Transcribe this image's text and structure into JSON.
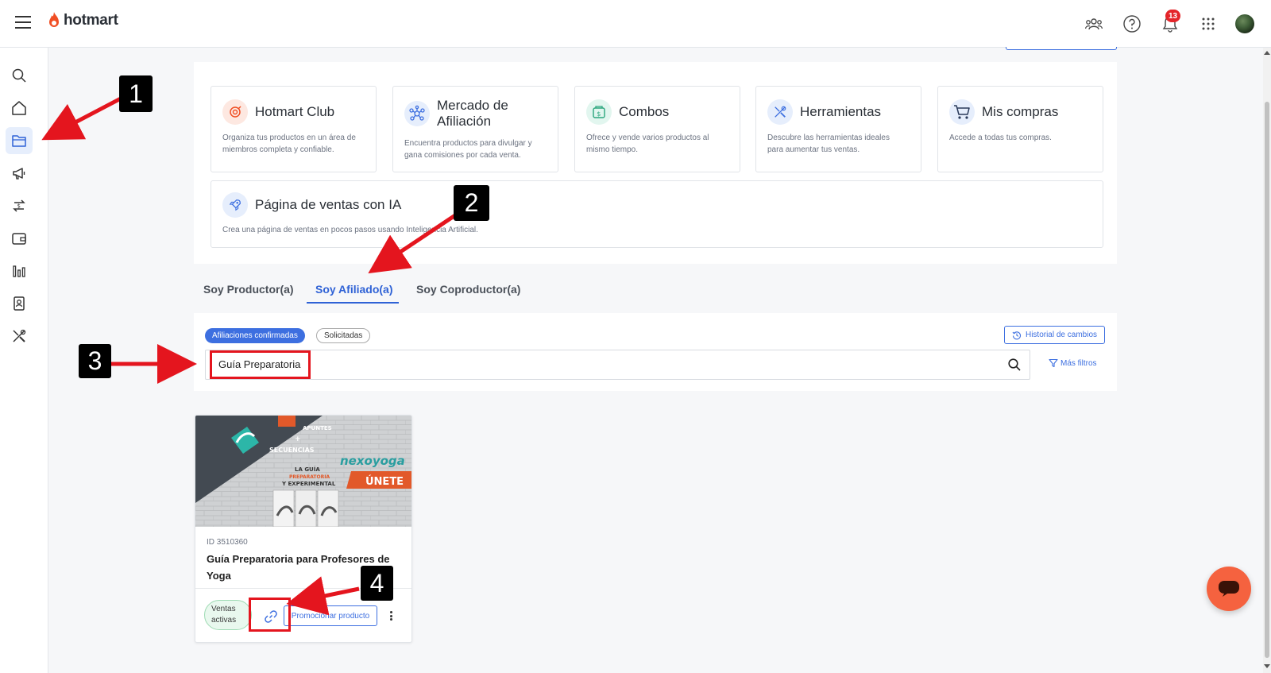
{
  "header": {
    "brand": "hotmart",
    "notifications_count": "13"
  },
  "sidebar": {
    "items": [
      {
        "icon": "search-icon"
      },
      {
        "icon": "home-icon"
      },
      {
        "icon": "folder-icon",
        "active": true
      },
      {
        "icon": "megaphone-icon"
      },
      {
        "icon": "exchange-icon"
      },
      {
        "icon": "wallet-icon"
      },
      {
        "icon": "bar-chart-icon"
      },
      {
        "icon": "contact-card-icon"
      },
      {
        "icon": "tools-icon"
      }
    ]
  },
  "tools": [
    {
      "title": "Hotmart Club",
      "description": "Organiza tus productos en un área de miembros completa y confiable.",
      "icon": "club-icon"
    },
    {
      "title": "Mercado de Afiliación",
      "description": "Encuentra productos para divulgar y gana comisiones por cada venta.",
      "icon": "network-icon"
    },
    {
      "title": "Combos",
      "description": "Ofrece y vende varios productos al mismo tiempo.",
      "icon": "combo-icon"
    },
    {
      "title": "Herramientas",
      "description": "Descubre las herramientas ideales para aumentar tus ventas.",
      "icon": "tools-icon"
    },
    {
      "title": "Mis compras",
      "description": "Accede a todas tus compras.",
      "icon": "cart-icon"
    },
    {
      "title": "Página de ventas con IA",
      "description": "Crea una página de ventas en pocos pasos usando Inteligencia Artificial.",
      "icon": "rocket-icon"
    }
  ],
  "tabs": [
    {
      "label": "Soy Productor(a)",
      "active": false
    },
    {
      "label": "Soy Afiliado(a)",
      "active": true
    },
    {
      "label": "Soy Coproductor(a)",
      "active": false
    }
  ],
  "filters": {
    "chip_confirmed": "Afiliaciones confirmadas",
    "chip_requested": "Solicitadas",
    "history_button": "Historial de cambios",
    "more_filters": "Más filtros"
  },
  "search": {
    "value": "Guía Preparatoria"
  },
  "product": {
    "id": "ID 3510360",
    "title": "Guía Preparatoria para Profesores de Yoga",
    "status": "Ventas activas",
    "promote_label": "Promocionar producto",
    "image_text": {
      "line1": "APUNTES",
      "plus": "+",
      "line2": "SECUENCIAS",
      "line3": "LA GUÍA",
      "line4": "PREPARATORIA",
      "line5": "Y EXPERIMENTAL",
      "brand": "nexoyoga",
      "cta": "ÚNETE"
    }
  },
  "annotations": {
    "markers": [
      "1",
      "2",
      "3",
      "4"
    ],
    "color": "#e4151e"
  }
}
